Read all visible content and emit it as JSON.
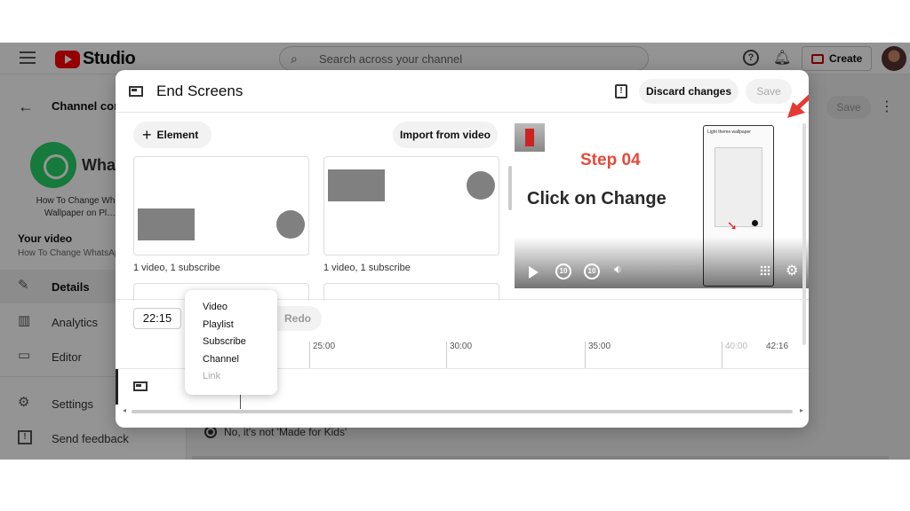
{
  "topbar": {
    "logo_text": "Studio",
    "search_placeholder": "Search across your channel",
    "help_glyph": "?",
    "create_label": "Create"
  },
  "sidebar": {
    "channel_content_label": "Channel cont",
    "channel_name_partial": "Wha",
    "video_title_partial": "How To Change Wh… Wallpaper on Pl…",
    "your_video_label": "Your video",
    "your_video_title": "How To Change WhatsAp",
    "items": [
      {
        "label": "Details",
        "icon": "pencil-icon",
        "glyph": "✎",
        "active": true
      },
      {
        "label": "Analytics",
        "icon": "analytics-icon",
        "glyph": "▥",
        "active": false
      },
      {
        "label": "Editor",
        "icon": "editor-icon",
        "glyph": "▭",
        "active": false
      },
      {
        "label": "Settings",
        "icon": "gear-icon",
        "glyph": "⚙",
        "active": false
      },
      {
        "label": "Send feedback",
        "icon": "feedback-icon",
        "glyph": "!",
        "active": false
      }
    ]
  },
  "background": {
    "save_label": "Save",
    "radio_label": "No, it's not 'Made for Kids'"
  },
  "modal": {
    "title": "End Screens",
    "feedback_glyph": "!",
    "discard_label": "Discard changes",
    "save_label": "Save",
    "element_label": "Element",
    "import_label": "Import from video",
    "templates": [
      {
        "label": "1 video, 1 subscribe"
      },
      {
        "label": "1 video, 1 subscribe"
      }
    ],
    "preview": {
      "step_text": "Step 04",
      "headline": "Click on Change",
      "phone_header": "Light theme wallpaper"
    },
    "timeline": {
      "current_time": "22:15",
      "redo_label": "Redo",
      "ticks": [
        "25:00",
        "30:00",
        "35:00",
        "40:00",
        "42:16"
      ]
    },
    "element_menu": [
      "Video",
      "Playlist",
      "Subscribe",
      "Channel",
      "Link"
    ]
  },
  "colors": {
    "accent_red": "#ff0000",
    "step_red": "#e8483a",
    "whatsapp_green": "#25d366",
    "annotation_arrow": "#e53935"
  }
}
